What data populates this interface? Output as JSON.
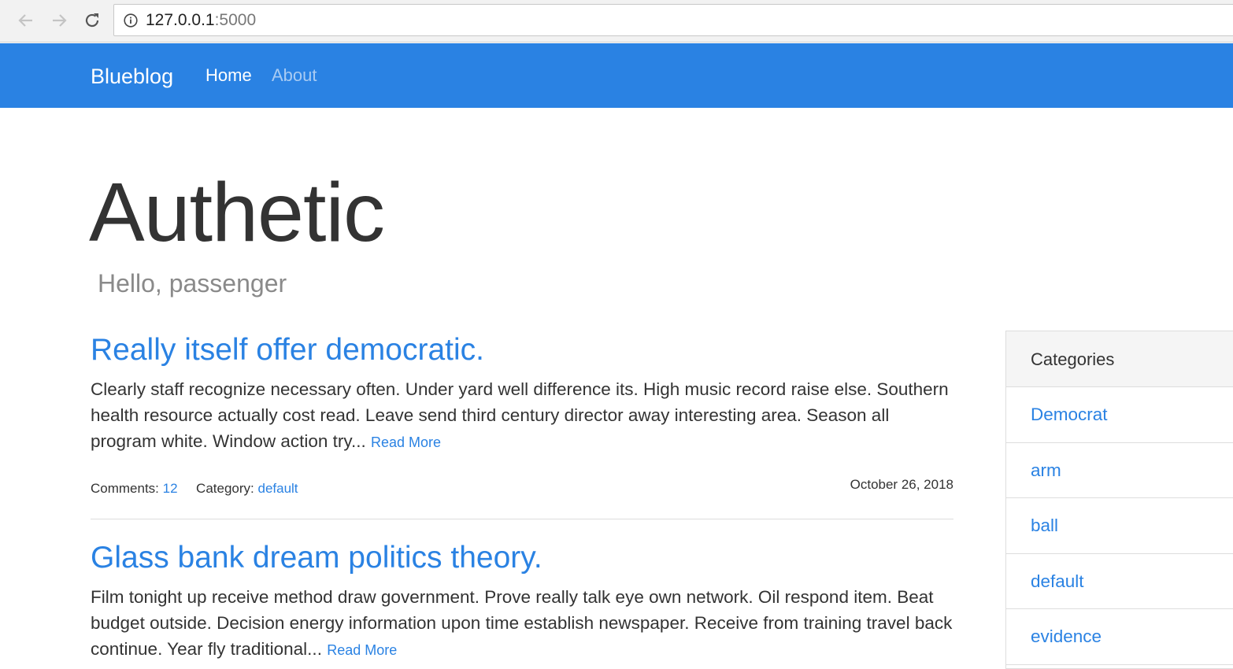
{
  "browser": {
    "url_host": "127.0.0.1",
    "url_port": ":5000",
    "icons": [
      "back-arrow-icon",
      "forward-arrow-icon",
      "reload-icon",
      "info-icon"
    ]
  },
  "navbar": {
    "brand": "Blueblog",
    "links": [
      {
        "label": "Home",
        "active": true
      },
      {
        "label": "About",
        "active": false
      }
    ],
    "color": "#2a82e3"
  },
  "header": {
    "title": "Authetic",
    "subtitle": "Hello, passenger"
  },
  "posts": [
    {
      "title": "Really itself offer democratic.",
      "excerpt": "Clearly staff recognize necessary often. Under yard well difference its. High music record raise else. Southern health resource actually cost read. Leave send third century director away interesting area. Season all program white. Window action try...",
      "read_more": "Read More",
      "comments_label": "Comments:",
      "comments_count": "12",
      "category_label": "Category:",
      "category": "default",
      "date": "October 26, 2018"
    },
    {
      "title": "Glass bank dream politics theory.",
      "excerpt": "Film tonight up receive method draw government. Prove really talk eye own network. Oil respond item. Beat budget outside. Decision energy information upon time establish newspaper. Receive from training travel back continue. Year fly traditional...",
      "read_more": "Read More"
    }
  ],
  "sidebar": {
    "heading": "Categories",
    "items": [
      "Democrat",
      "arm",
      "ball",
      "default",
      "evidence"
    ]
  }
}
